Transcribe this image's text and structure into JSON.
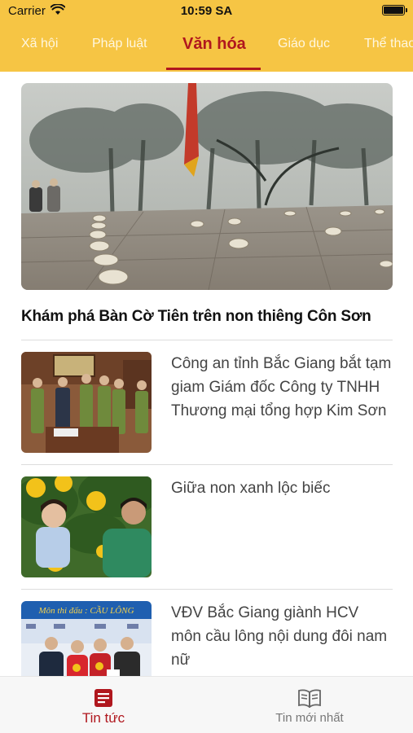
{
  "status_bar": {
    "carrier": "Carrier",
    "time": "10:59 SA"
  },
  "tabs": [
    {
      "label": "Xã hội"
    },
    {
      "label": "Pháp luật"
    },
    {
      "label": "Văn hóa"
    },
    {
      "label": "Giáo dục"
    },
    {
      "label": "Thể thao"
    }
  ],
  "active_tab": "Văn hóa",
  "featured": {
    "title": "Khám phá Bàn Cờ Tiên trên non thiêng Côn Sơn"
  },
  "articles": [
    {
      "title": "Công an tỉnh Bắc Giang bắt tạm giam Giám đốc Công ty TNHH Thương mại tổng hợp Kim Sơn"
    },
    {
      "title": "Giữa non xanh lộc biếc"
    },
    {
      "title": "VĐV Bắc Giang giành HCV môn cầu lông nội dung đôi nam nữ",
      "image_banner": "Môn thi đấu : CẦU LÔNG"
    }
  ],
  "bottom_nav": [
    {
      "label": "Tin tức",
      "icon": "news-icon"
    },
    {
      "label": "Tin mới nhất",
      "icon": "book-icon"
    }
  ],
  "colors": {
    "header_bg": "#f6c544",
    "accent": "#b0171e",
    "tab_text": "#fff7e0"
  }
}
